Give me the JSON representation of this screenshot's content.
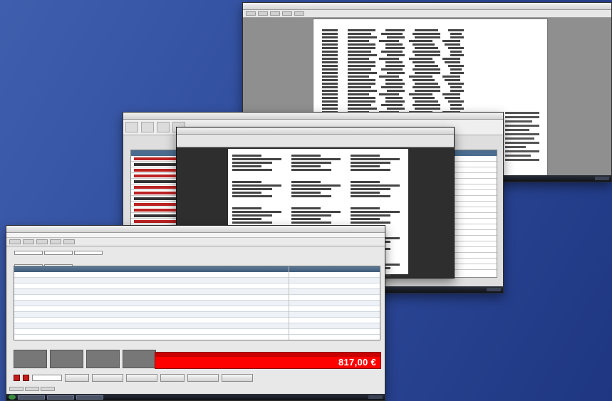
{
  "invoice": {
    "total_amount": "817,00 €"
  },
  "colors": {
    "background": "#2f4c9c",
    "total_panel": "#ff0000",
    "grid_header": "#4a6d8f",
    "grid_red_text": "#bb2222"
  },
  "icons": [
    "start-orb-icon"
  ]
}
